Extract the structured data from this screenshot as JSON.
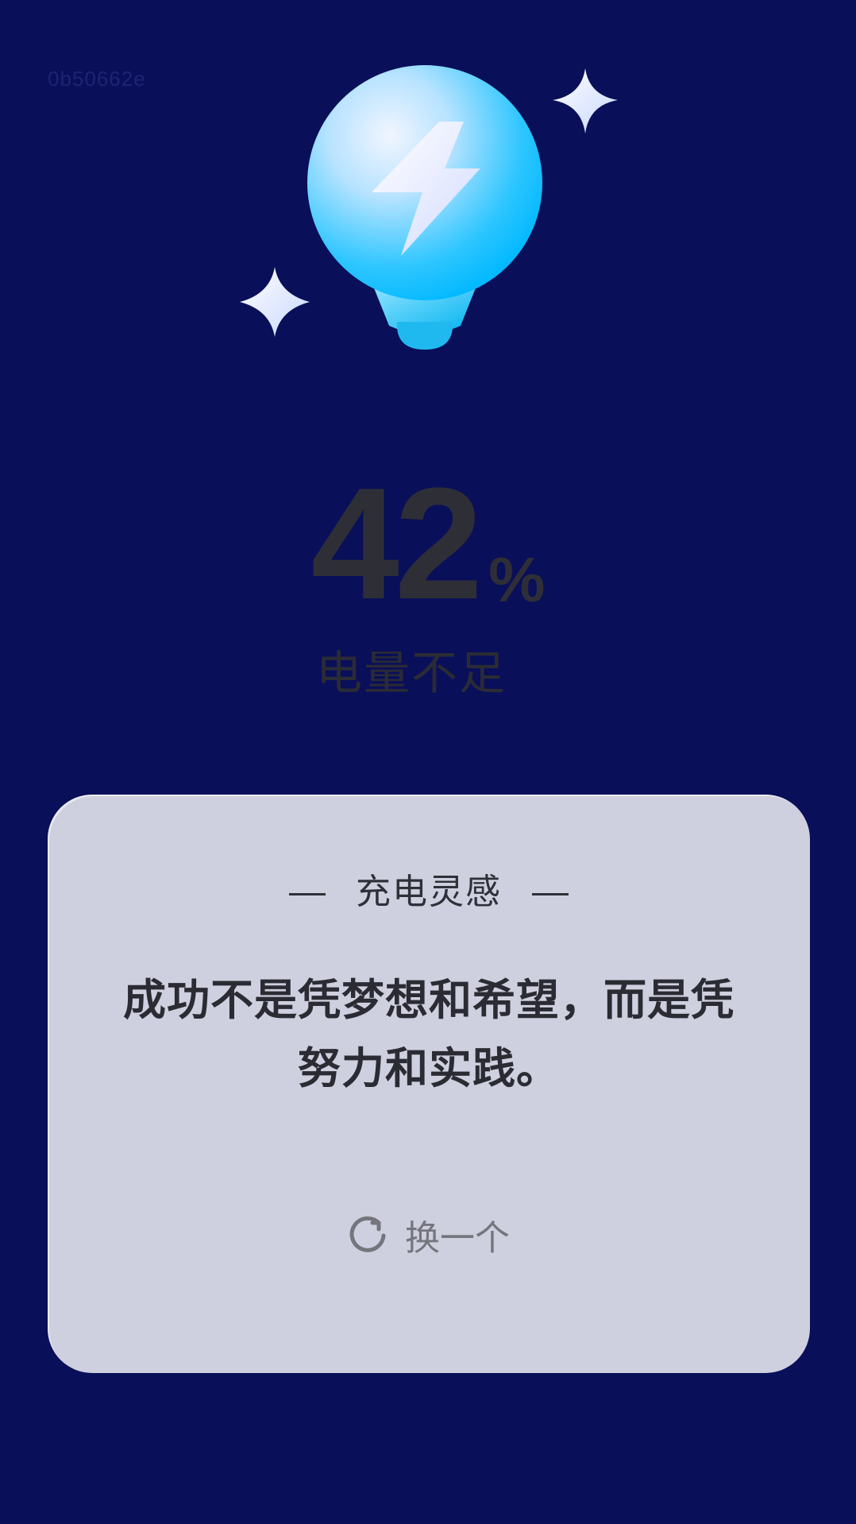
{
  "debug_id": "0b50662e",
  "battery": {
    "level": "42",
    "unit": "%",
    "status": "电量不足"
  },
  "card": {
    "title": "充电灵感",
    "quote": "成功不是凭梦想和希望，而是凭努力和实践。",
    "refresh_label": "换一个"
  },
  "icons": {
    "hero": "lightbulb-lightning-icon",
    "sparkle": "sparkle-icon",
    "refresh": "refresh-icon"
  },
  "colors": {
    "background": "#0a0f59",
    "card": "#cfd0df",
    "bulb": "#2fc6ff"
  }
}
